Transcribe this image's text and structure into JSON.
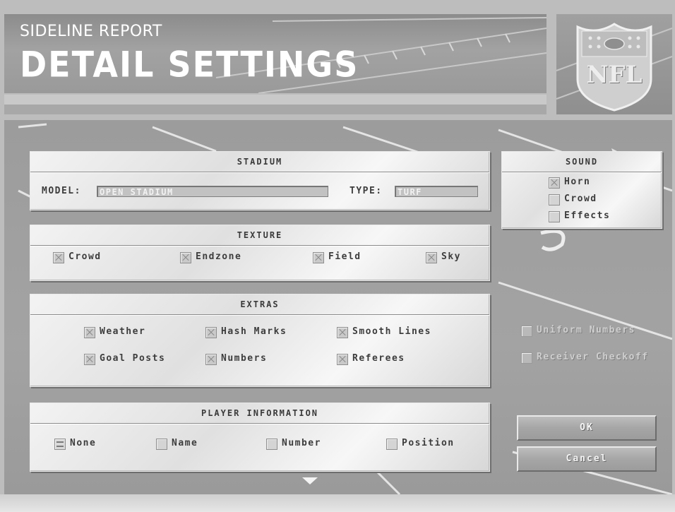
{
  "header": {
    "subtitle": "SIDELINE REPORT",
    "title": "DETAIL SETTINGS",
    "logo": "NFL"
  },
  "stadium": {
    "title": "STADIUM",
    "model_label": "MODEL:",
    "model_value": "OPEN STADIUM",
    "type_label": "TYPE:",
    "type_value": "TURF"
  },
  "sound": {
    "title": "SOUND",
    "items": [
      {
        "label": "Horn",
        "checked": true
      },
      {
        "label": "Crowd",
        "checked": false
      },
      {
        "label": "Effects",
        "checked": false
      }
    ]
  },
  "texture": {
    "title": "TEXTURE",
    "items": [
      {
        "label": "Crowd",
        "checked": true
      },
      {
        "label": "Endzone",
        "checked": true
      },
      {
        "label": "Field",
        "checked": true
      },
      {
        "label": "Sky",
        "checked": true
      }
    ]
  },
  "extras": {
    "title": "EXTRAS",
    "items": [
      {
        "label": "Weather",
        "checked": true
      },
      {
        "label": "Hash Marks",
        "checked": true
      },
      {
        "label": "Smooth Lines",
        "checked": true
      },
      {
        "label": "Goal Posts",
        "checked": true
      },
      {
        "label": "Numbers",
        "checked": true
      },
      {
        "label": "Referees",
        "checked": true
      }
    ]
  },
  "extras_disabled": {
    "items": [
      {
        "label": "Uniform Numbers",
        "checked": false
      },
      {
        "label": "Receiver Checkoff",
        "checked": false
      }
    ]
  },
  "player_info": {
    "title": "PLAYER INFORMATION",
    "options": [
      {
        "label": "None",
        "selected": true
      },
      {
        "label": "Name",
        "selected": false
      },
      {
        "label": "Number",
        "selected": false
      },
      {
        "label": "Position",
        "selected": false
      }
    ]
  },
  "buttons": {
    "ok": "OK",
    "cancel": "Cancel"
  }
}
